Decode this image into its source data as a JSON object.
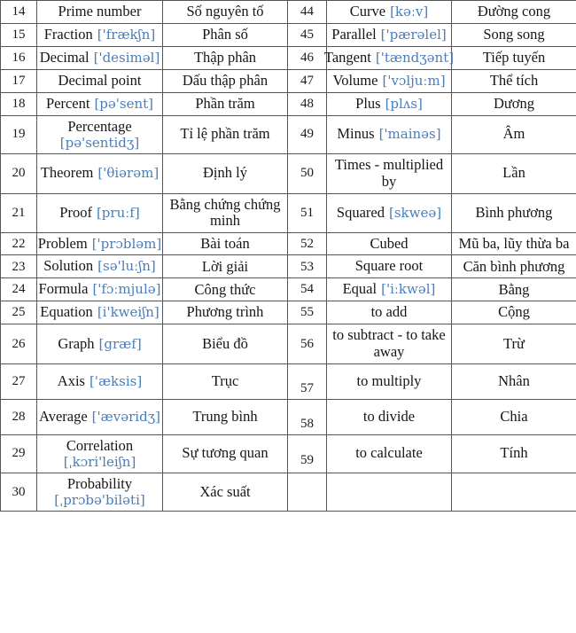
{
  "table": {
    "columns": [
      "no",
      "english_term",
      "english_ipa",
      "vietnamese"
    ],
    "left_rows": [
      {
        "no": "14",
        "term": "Prime number",
        "ipa": "",
        "viet": "Số nguyên tố",
        "layout": "inline"
      },
      {
        "no": "15",
        "term": "Fraction",
        "ipa": "['frækʃn]",
        "viet": "Phân số",
        "layout": "inline"
      },
      {
        "no": "16",
        "term": "Decimal",
        "ipa": "['desiməl]",
        "viet": "Thập phân",
        "layout": "inline"
      },
      {
        "no": "17",
        "term": "Decimal point",
        "ipa": "",
        "viet": "Dấu thập phân",
        "layout": "inline"
      },
      {
        "no": "18",
        "term": "Percent",
        "ipa": "[pə'sent]",
        "viet": "Phần trăm",
        "layout": "inline"
      },
      {
        "no": "19",
        "term": "Percentage",
        "ipa": "[pə'sentidʒ]",
        "viet": "Tỉ lệ phần trăm",
        "layout": "stack"
      },
      {
        "no": "20",
        "term": "Theorem",
        "ipa": "['θiərəm]",
        "viet": "Định lý",
        "layout": "inline"
      },
      {
        "no": "21",
        "term": "Proof",
        "ipa": "[pruːf]",
        "viet": "Bằng chứng chứng minh",
        "layout": "inline"
      },
      {
        "no": "22",
        "term": "Problem",
        "ipa": "['prɔbləm]",
        "viet": "Bài toán",
        "layout": "inline"
      },
      {
        "no": "23",
        "term": "Solution",
        "ipa": "[sə'luːʃn]",
        "viet": "Lời giải",
        "layout": "inline"
      },
      {
        "no": "24",
        "term": "Formula",
        "ipa": "['fɔːmjulə]",
        "viet": "Công thức",
        "layout": "inline"
      },
      {
        "no": "25",
        "term": "Equation",
        "ipa": "[i'kweiʃn]",
        "viet": "Phương trình",
        "layout": "inline"
      },
      {
        "no": "26",
        "term": "Graph",
        "ipa": "[græf]",
        "viet": "Biểu đồ",
        "layout": "inline"
      },
      {
        "no": "27",
        "term": "Axis",
        "ipa": "['æksis]",
        "viet": "Trục",
        "layout": "inline"
      },
      {
        "no": "28",
        "term": "Average",
        "ipa": "['ævəridʒ]",
        "viet": "Trung bình",
        "layout": "inline"
      },
      {
        "no": "29",
        "term": "Correlation",
        "ipa": "[ˌkɔri'leiʃn]",
        "viet": "Sự tương quan",
        "layout": "stack"
      },
      {
        "no": "30",
        "term": "Probability",
        "ipa": "[ˌprɔbə'biləti]",
        "viet": "Xác suất",
        "layout": "stack"
      }
    ],
    "right_rows": [
      {
        "no": "44",
        "term": "Curve",
        "ipa": "[kəːv]",
        "viet": "Đường cong",
        "layout": "inline"
      },
      {
        "no": "45",
        "term": "Parallel",
        "ipa": "['pærəlel]",
        "viet": "Song song",
        "layout": "inline"
      },
      {
        "no": "46",
        "term": "Tangent",
        "ipa": "['tændʒənt]",
        "viet": "Tiếp tuyến",
        "layout": "inline"
      },
      {
        "no": "47",
        "term": "Volume",
        "ipa": "['vɔljuːm]",
        "viet": "Thể tích",
        "layout": "inline"
      },
      {
        "no": "48",
        "term": "Plus",
        "ipa": "[plʌs]",
        "viet": "Dương",
        "layout": "inline"
      },
      {
        "no": "49",
        "term": "Minus",
        "ipa": "['mainəs]",
        "viet": "Âm",
        "layout": "inline"
      },
      {
        "no": "50",
        "term": "Times - multiplied by",
        "ipa": "",
        "viet": "Lần",
        "layout": "inline"
      },
      {
        "no": "51",
        "term": "Squared",
        "ipa": "[skweə]",
        "viet": "Bình phương",
        "layout": "inline"
      },
      {
        "no": "52",
        "term": "Cubed",
        "ipa": "",
        "viet": "Mũ ba, lũy thừa ba",
        "layout": "inline"
      },
      {
        "no": "53",
        "term": "Square root",
        "ipa": "",
        "viet": "Căn bình phương",
        "layout": "inline"
      },
      {
        "no": "54",
        "term": "Equal",
        "ipa": "['iːkwəl]",
        "viet": "Bằng",
        "layout": "inline"
      },
      {
        "no": "55",
        "term": "to add",
        "ipa": "",
        "viet": "Cộng",
        "layout": "inline"
      },
      {
        "no": "56",
        "term": "to subtract - to take away",
        "ipa": "",
        "viet": "Trừ",
        "layout": "inline"
      },
      {
        "no": "57",
        "term": "to multiply",
        "ipa": "",
        "viet": "Nhân",
        "layout": "inline",
        "num_low": true
      },
      {
        "no": "58",
        "term": "to divide",
        "ipa": "",
        "viet": "Chia",
        "layout": "inline",
        "num_low": true
      },
      {
        "no": "59",
        "term": "to calculate",
        "ipa": "",
        "viet": "Tính",
        "layout": "inline",
        "num_low": true
      },
      {
        "no": "",
        "term": "",
        "ipa": "",
        "viet": "",
        "layout": "inline",
        "empty": true
      }
    ]
  },
  "colors": {
    "ipa": "#4a7ebb",
    "text": "#161616",
    "border": "#555555",
    "empty_border": "#d8d8d8",
    "background": "#ffffff"
  }
}
